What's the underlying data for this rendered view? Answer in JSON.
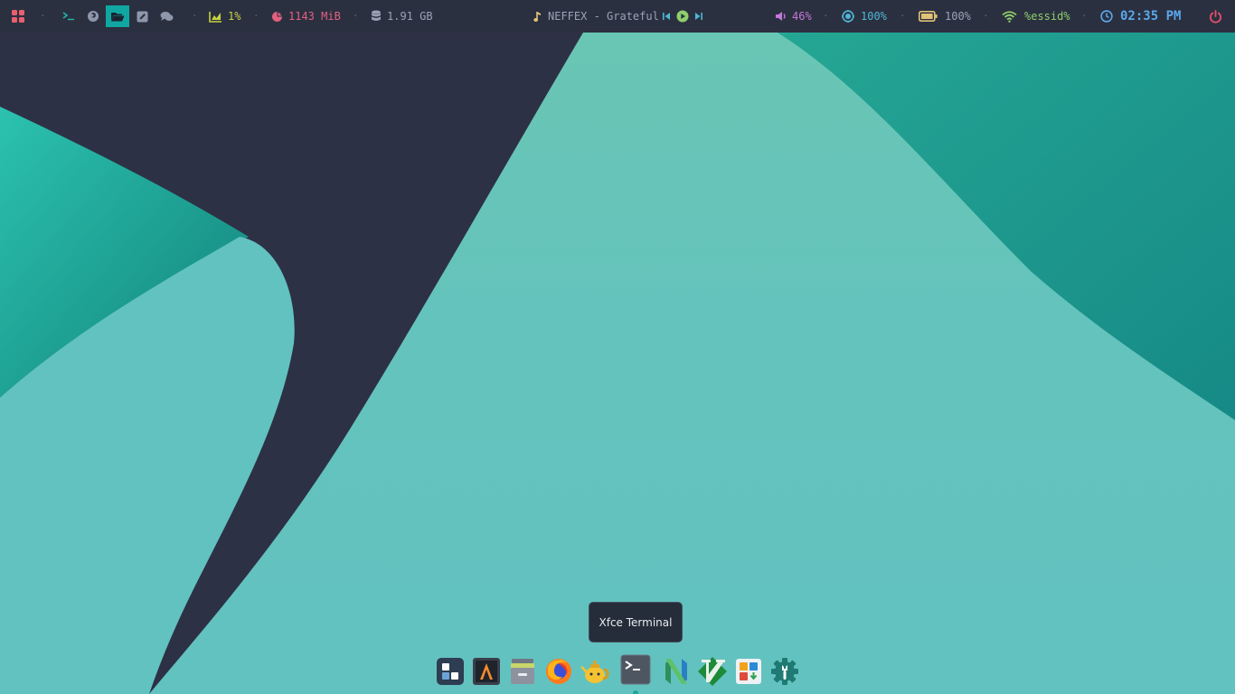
{
  "topbar": {
    "workspaces": [
      {
        "name": "terminal",
        "icon": "terminal-icon"
      },
      {
        "name": "firefox",
        "icon": "firefox-icon"
      },
      {
        "name": "files",
        "icon": "folder-open-icon",
        "active": true
      },
      {
        "name": "editor",
        "icon": "pencil-square-icon"
      },
      {
        "name": "chat",
        "icon": "chat-bubbles-icon"
      }
    ],
    "cpu": "1%",
    "memory": "1143 MiB",
    "disk": "1.91 GB",
    "music": {
      "track": "NEFFEX - Grateful"
    },
    "volume": "46%",
    "brightness": "100%",
    "battery": "100%",
    "wifi": "%essid%",
    "time": "02:35 PM",
    "colors": {
      "bar_bg": "#2b3040",
      "cpu": "#c7d33f",
      "memory": "#e2607f",
      "disk": "#9aa3b5",
      "volume": "#c477d8",
      "brightness": "#4fb6d6",
      "battery": "#e1c377",
      "wifi": "#8fcf6b",
      "clock": "#5aa8ea",
      "power": "#e8506c",
      "active_workspace": "#10a7a3"
    }
  },
  "tooltip": {
    "text": "Xfce Terminal"
  },
  "dock": {
    "items": [
      {
        "name": "app-grid",
        "icon": "app-grid-icon"
      },
      {
        "name": "alacritty",
        "icon": "alacritty-icon"
      },
      {
        "name": "archive-manager",
        "icon": "archive-icon"
      },
      {
        "name": "firefox",
        "icon": "firefox-icon"
      },
      {
        "name": "teapot",
        "icon": "teapot-icon"
      },
      {
        "name": "xfce-terminal",
        "icon": "terminal-icon",
        "running": true
      },
      {
        "name": "neovim",
        "icon": "neovim-icon"
      },
      {
        "name": "vim",
        "icon": "vim-icon"
      },
      {
        "name": "software-store",
        "icon": "store-icon"
      },
      {
        "name": "settings",
        "icon": "settings-gear-icon"
      }
    ]
  }
}
